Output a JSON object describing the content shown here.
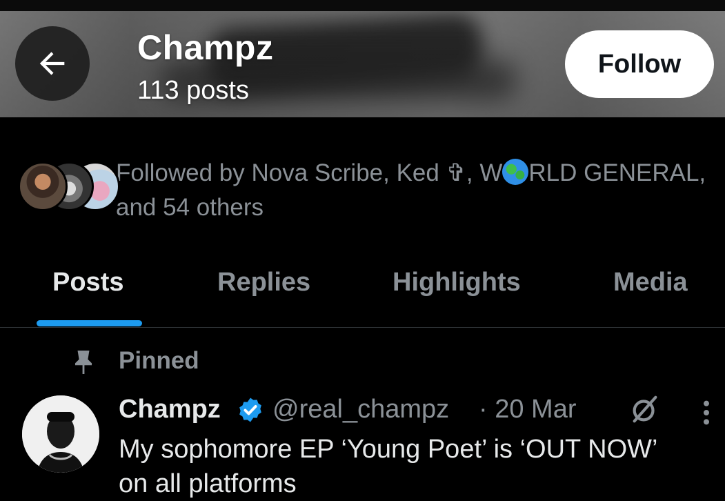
{
  "header": {
    "title": "Champz",
    "post_count": "113 posts",
    "follow_label": "Follow"
  },
  "followed_by": {
    "prefix": "Followed by Nova Scribe, Ked ✞, W",
    "suffix": "RLD GENERAL,",
    "line2": "and 54 others"
  },
  "tabs": [
    {
      "label": "Posts",
      "active": true
    },
    {
      "label": "Replies",
      "active": false
    },
    {
      "label": "Highlights",
      "active": false
    },
    {
      "label": "Media",
      "active": false
    }
  ],
  "pinned_post": {
    "pinned_label": "Pinned",
    "author": "Champz",
    "handle": "@real_champz",
    "time": "· 20 Mar",
    "text": "My sophomore EP ‘Young Poet’ is ‘OUT NOW’",
    "text_line2": "on all platforms"
  },
  "icons": {
    "back": "arrow-left-icon",
    "globe": "globe-emoji-icon",
    "pin": "pin-icon",
    "verified": "verified-badge-icon",
    "grok": "grok-icon",
    "more": "more-vertical-icon"
  },
  "colors": {
    "background": "#000000",
    "accent": "#1d9bf0",
    "muted_text": "#8b9197",
    "primary_text": "#e7e9ea"
  }
}
